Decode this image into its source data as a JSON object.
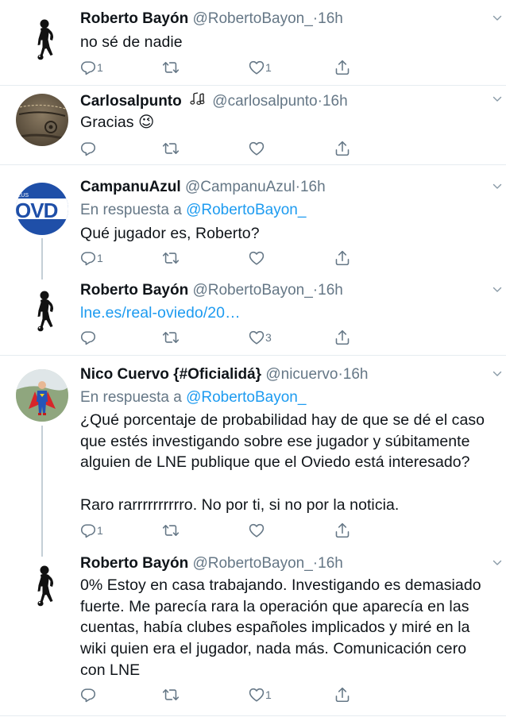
{
  "tweets": [
    {
      "name": "Roberto Bayón",
      "handle": "@RobertoBayon_",
      "dot": "·",
      "time": "16h",
      "reply_to_prefix": "",
      "reply_to_mention": "",
      "text": "no sé de nadie",
      "counts": {
        "reply": "1",
        "retweet": "",
        "like": "1"
      }
    },
    {
      "name": "Carlosalpunto",
      "handle": "@carlosalpunto",
      "dot": "·",
      "time": "16h",
      "reply_to_prefix": "",
      "reply_to_mention": "",
      "text": "Gracias 😉",
      "counts": {
        "reply": "",
        "retweet": "",
        "like": ""
      }
    },
    {
      "name": "CampanuAzul",
      "handle": "@CampanuAzul",
      "dot": "·",
      "time": "16h",
      "reply_to_prefix": "En respuesta a ",
      "reply_to_mention": "@RobertoBayon_",
      "text": "Qué jugador es, Roberto?",
      "counts": {
        "reply": "1",
        "retweet": "",
        "like": ""
      }
    },
    {
      "name": "Roberto Bayón",
      "handle": "@RobertoBayon_",
      "dot": "·",
      "time": "16h",
      "reply_to_prefix": "",
      "reply_to_mention": "",
      "text": "lne.es/real-oviedo/20…",
      "counts": {
        "reply": "",
        "retweet": "",
        "like": "3"
      }
    },
    {
      "name": "Nico Cuervo {#Oficialidá}",
      "handle": "@nicuervo",
      "dot": "·",
      "time": "16h",
      "reply_to_prefix": "En respuesta a ",
      "reply_to_mention": "@RobertoBayon_",
      "text": "¿Qué porcentaje de probabilidad hay de que se dé el caso que estés investigando sobre ese jugador y súbitamente alguien de LNE publique que el Oviedo está interesado?\n\nRaro rarrrrrrrrrro. No por ti, si no por la noticia.",
      "counts": {
        "reply": "1",
        "retweet": "",
        "like": ""
      }
    },
    {
      "name": "Roberto Bayón",
      "handle": "@RobertoBayon_",
      "dot": "·",
      "time": "16h",
      "reply_to_prefix": "",
      "reply_to_mention": "",
      "text": "0% Estoy en casa trabajando. Investigando es demasiado fuerte. Me parecía rara la operación que aparecía en las cuentas, había clubes españoles implicados y miré en la wiki quien era el jugador, nada más. Comunicación cero con LNE",
      "counts": {
        "reply": "",
        "retweet": "",
        "like": "1"
      }
    }
  ],
  "avatar_text": {
    "campanu": "OVD",
    "campanu_small": "ZUS"
  },
  "colors": {
    "name": "#0f1419",
    "secondary": "#657786",
    "link": "#1d9bf0",
    "divider": "#e6ecf0",
    "thread": "#c4cfd6"
  },
  "icons": {
    "reply": "comment-icon",
    "retweet": "retweet-icon",
    "like": "heart-icon",
    "share": "share-icon",
    "more": "chevron-down-icon",
    "badge": "music-notes-icon"
  }
}
